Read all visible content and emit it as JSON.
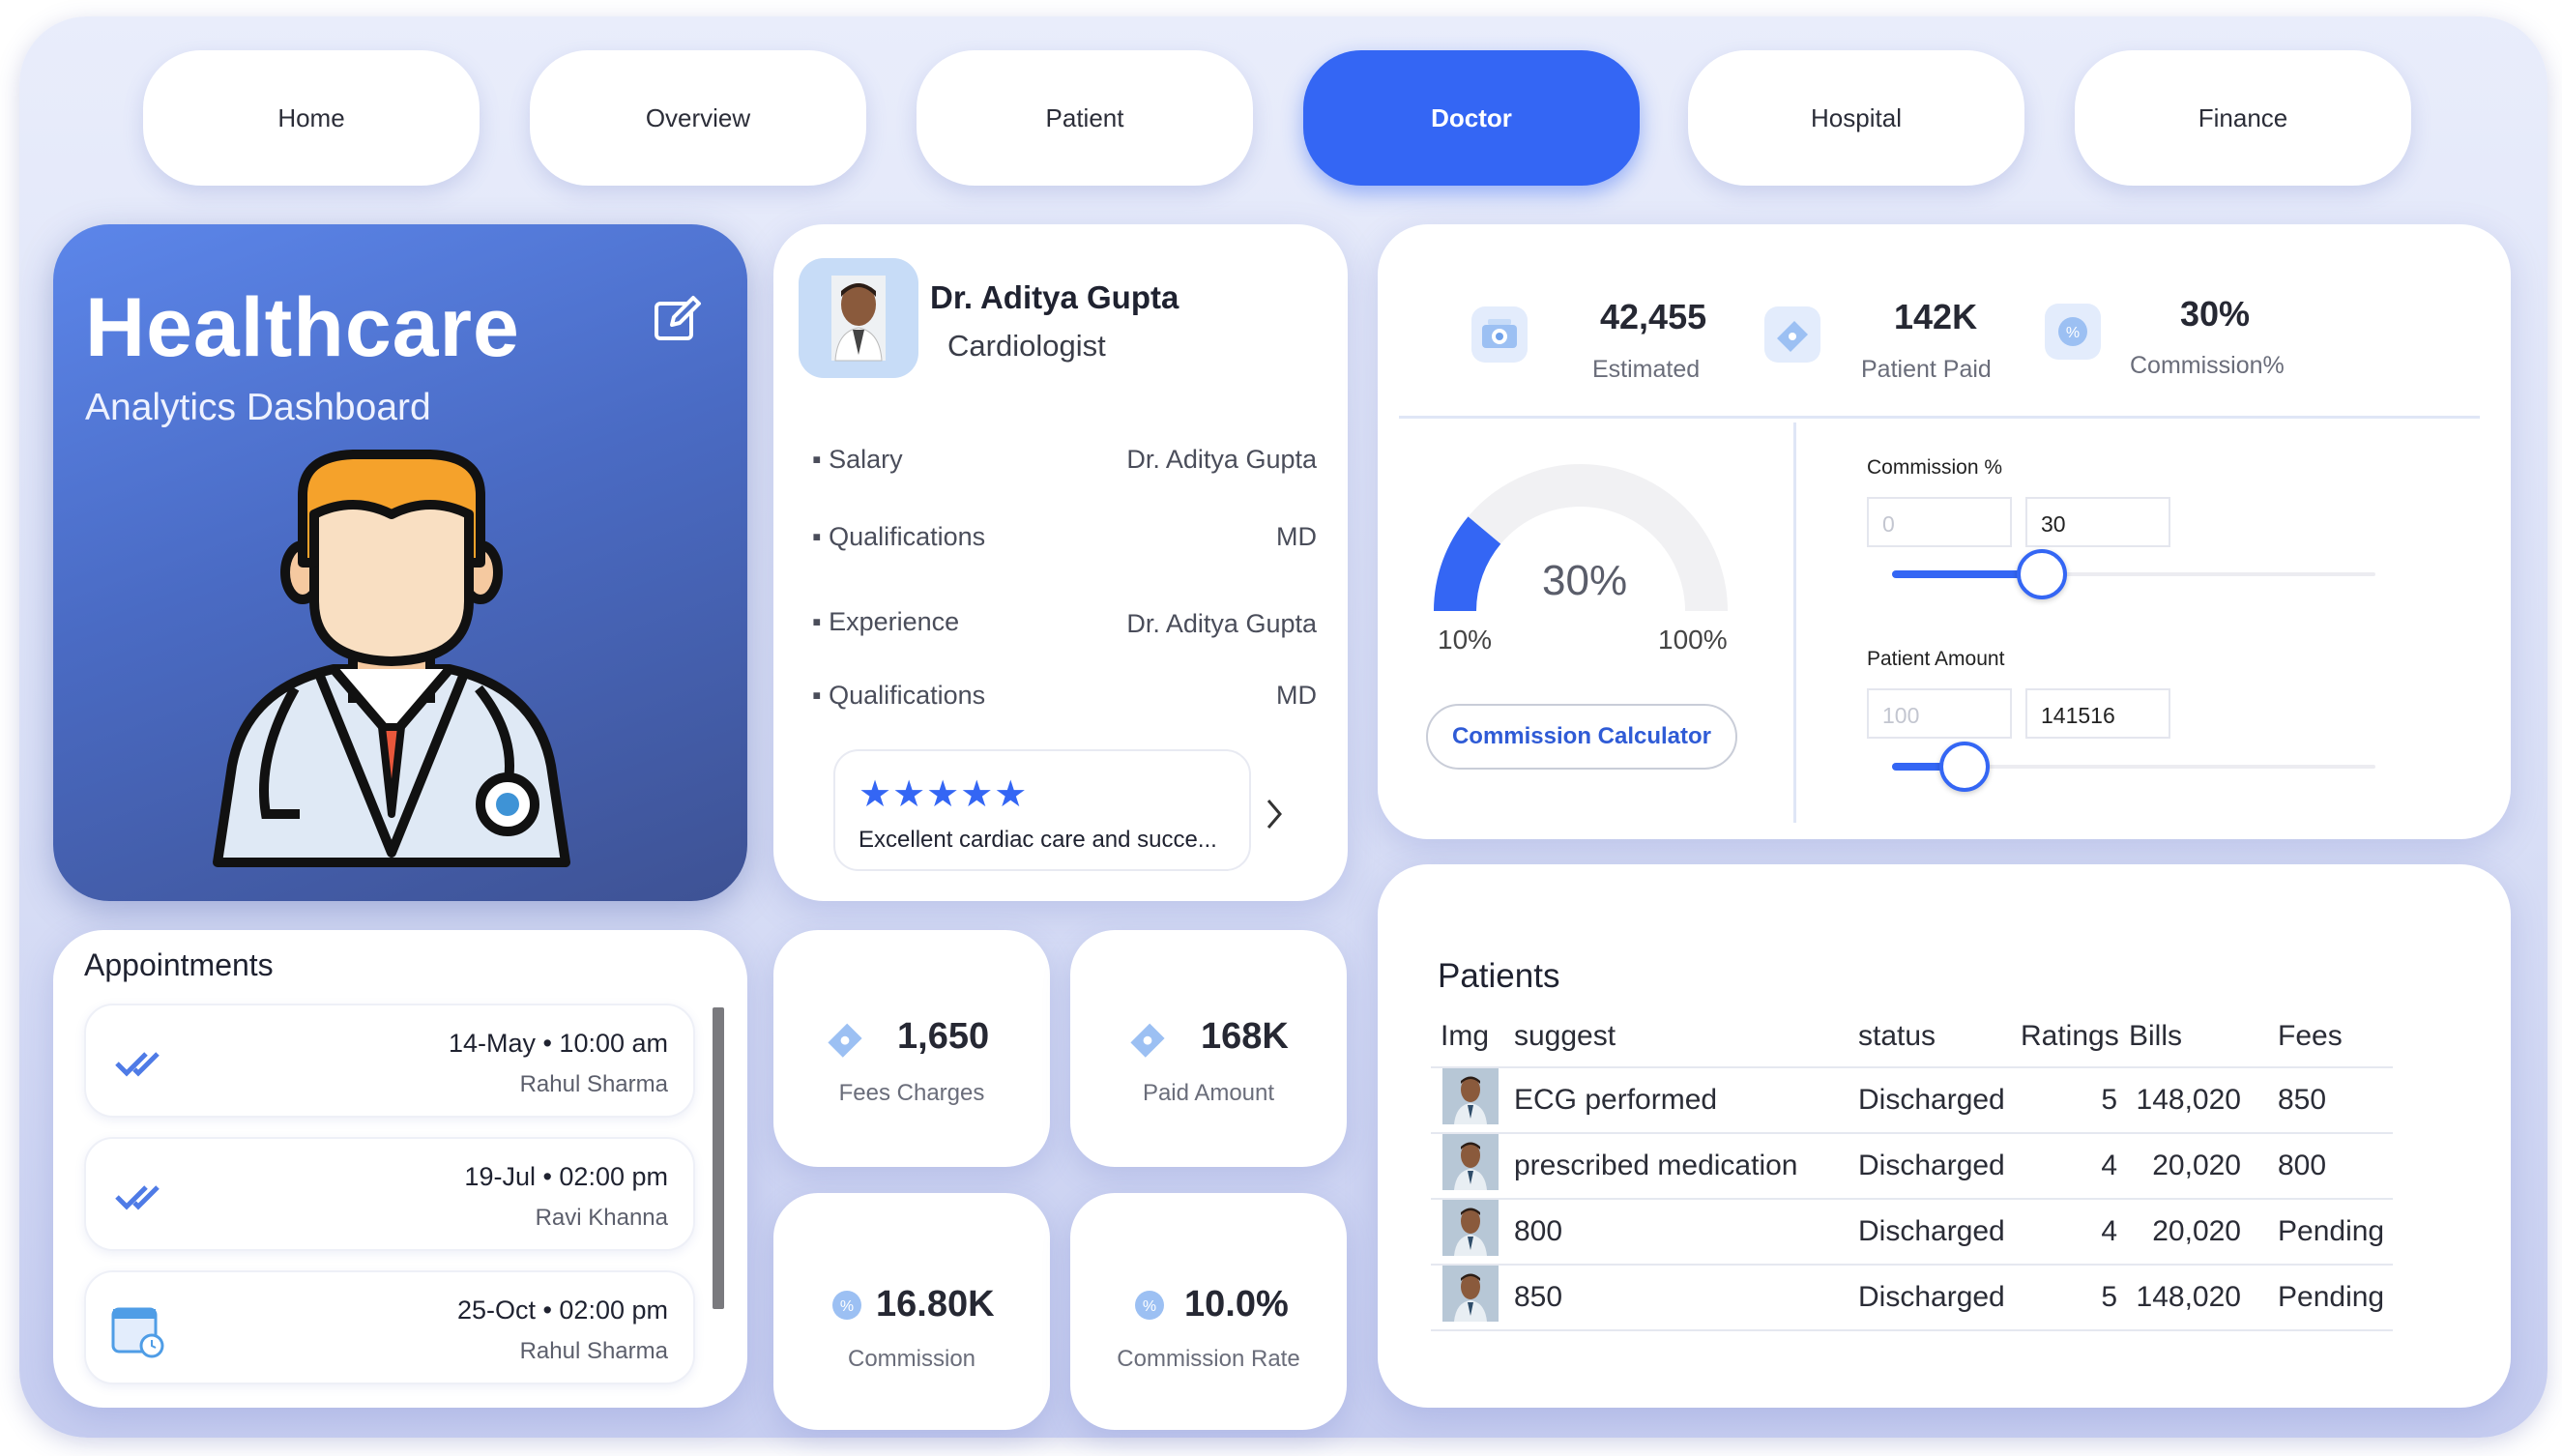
{
  "nav": {
    "items": [
      {
        "label": "Home"
      },
      {
        "label": "Overview"
      },
      {
        "label": "Patient"
      },
      {
        "label": "Doctor",
        "active": true
      },
      {
        "label": "Hospital"
      },
      {
        "label": "Finance"
      }
    ]
  },
  "hero": {
    "title": "Healthcare",
    "subtitle": "Analytics Dashboard",
    "edit_icon": "edit-icon",
    "illustration": "doctor-illustration"
  },
  "doctor": {
    "name": "Dr. Aditya Gupta",
    "specialty": "Cardiologist",
    "details": [
      {
        "label": "Salary",
        "value": "Dr. Aditya Gupta"
      },
      {
        "label": "Qualifications",
        "value": "MD"
      },
      {
        "label": "Experience",
        "value": "Dr. Aditya Gupta"
      },
      {
        "label": "Qualifications",
        "value": "MD"
      }
    ],
    "review": {
      "stars": "★★★★★",
      "text": "Excellent cardiac care and succe...",
      "rating": 5
    }
  },
  "summary": {
    "kpis": [
      {
        "value": "42,455",
        "label": "Estimated",
        "icon": "money-icon"
      },
      {
        "value": "142K",
        "label": "Patient Paid",
        "icon": "ticket-icon"
      },
      {
        "value": "30%",
        "label": "Commission%",
        "icon": "percent-icon"
      }
    ],
    "gauge": {
      "value_text": "30%",
      "min_label": "10%",
      "max_label": "100%",
      "fraction": 0.222
    },
    "calc_button": "Commission Calculator"
  },
  "sliders": {
    "commission": {
      "label": "Commission %",
      "min": "0",
      "value": "30",
      "fraction": 0.31
    },
    "patient_amount": {
      "label": "Patient Amount",
      "min": "100",
      "value": "141516",
      "fraction": 0.15
    }
  },
  "appointments": {
    "title": "Appointments",
    "items": [
      {
        "datetime": "14-May • 10:00 am",
        "name": "Rahul Sharma",
        "icon": "double-check-icon"
      },
      {
        "datetime": "19-Jul • 02:00 pm",
        "name": "Ravi Khanna",
        "icon": "double-check-icon"
      },
      {
        "datetime": "25-Oct • 02:00 pm",
        "name": "Rahul Sharma",
        "icon": "calendar-clock-icon"
      }
    ]
  },
  "stats": [
    {
      "value": "1,650",
      "label": "Fees Charges",
      "icon": "ticket-icon"
    },
    {
      "value": "168K",
      "label": "Paid Amount",
      "icon": "ticket-icon"
    },
    {
      "value": "16.80K",
      "label": "Commission",
      "icon": "percent-icon"
    },
    {
      "value": "10.0%",
      "label": "Commission Rate",
      "icon": "percent-icon"
    }
  ],
  "patients": {
    "title": "Patients",
    "headers": [
      "Img",
      "suggest",
      "status",
      "Ratings",
      "Bills",
      "Fees"
    ],
    "rows": [
      {
        "suggest": "ECG performed",
        "status": "Discharged",
        "rating": "5",
        "bills": "148,020",
        "fees": "850"
      },
      {
        "suggest": "prescribed medication",
        "status": "Discharged",
        "rating": "4",
        "bills": "20,020",
        "fees": "800"
      },
      {
        "suggest": "800",
        "status": "Discharged",
        "rating": "4",
        "bills": "20,020",
        "fees": "Pending"
      },
      {
        "suggest": "850",
        "status": "Discharged",
        "rating": "5",
        "bills": "148,020",
        "fees": "Pending"
      }
    ]
  },
  "colors": {
    "accent": "#3466f4",
    "hero_top": "#5c86ea",
    "hero_bottom": "#3e5294",
    "background": "#dfe4f8"
  }
}
